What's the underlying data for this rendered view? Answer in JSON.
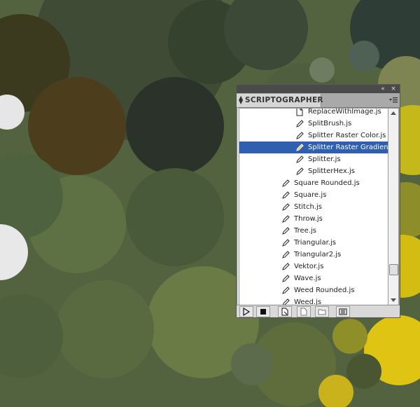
{
  "panel": {
    "title": "SCRIPTOGRAPHER",
    "titlebar_icons": [
      "collapse-icon",
      "close-icon"
    ],
    "menu_icon": "panel-menu-icon",
    "items": [
      {
        "label": "ReplaceWithImage.js",
        "icon": "document-icon",
        "indent": 2,
        "selected": false
      },
      {
        "label": "SplitBrush.js",
        "icon": "script-pen-icon",
        "indent": 2,
        "selected": false
      },
      {
        "label": "Splitter Raster Color.js",
        "icon": "script-pen-icon",
        "indent": 2,
        "selected": false
      },
      {
        "label": "Splitter Raster Gradient.js",
        "icon": "script-pen-icon",
        "indent": 2,
        "selected": true
      },
      {
        "label": "Splitter.js",
        "icon": "script-pen-icon",
        "indent": 2,
        "selected": false
      },
      {
        "label": "SplitterHex.js",
        "icon": "script-pen-icon",
        "indent": 2,
        "selected": false
      },
      {
        "label": "Square Rounded.js",
        "icon": "script-pen-icon",
        "indent": 1,
        "selected": false
      },
      {
        "label": "Square.js",
        "icon": "script-pen-icon",
        "indent": 1,
        "selected": false
      },
      {
        "label": "Stitch.js",
        "icon": "script-pen-icon",
        "indent": 1,
        "selected": false
      },
      {
        "label": "Throw.js",
        "icon": "script-pen-icon",
        "indent": 1,
        "selected": false
      },
      {
        "label": "Tree.js",
        "icon": "script-pen-icon",
        "indent": 1,
        "selected": false
      },
      {
        "label": "Triangular.js",
        "icon": "script-pen-icon",
        "indent": 1,
        "selected": false
      },
      {
        "label": "Triangular2.js",
        "icon": "script-pen-icon",
        "indent": 1,
        "selected": false
      },
      {
        "label": "Vektor.js",
        "icon": "script-pen-icon",
        "indent": 1,
        "selected": false
      },
      {
        "label": "Wave.js",
        "icon": "script-pen-icon",
        "indent": 1,
        "selected": false
      },
      {
        "label": "Weed Rounded.js",
        "icon": "script-pen-icon",
        "indent": 1,
        "selected": false
      },
      {
        "label": "Weed.js",
        "icon": "script-pen-icon",
        "indent": 1,
        "selected": false
      }
    ],
    "toolbar": [
      "play-icon",
      "stop-icon",
      "new-script-icon",
      "new-document-icon",
      "folder-icon",
      "console-icon"
    ]
  },
  "colors": {
    "selection": "#2f5fae",
    "panel_bg": "#e9e9e9"
  }
}
